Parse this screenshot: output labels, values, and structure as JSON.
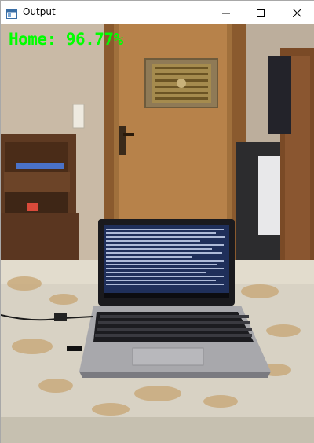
{
  "window": {
    "title": "Output",
    "icon": "opencv-window-icon"
  },
  "controls": {
    "minimize_icon": "minimize-icon",
    "maximize_icon": "maximize-icon",
    "close_icon": "close-icon"
  },
  "overlay": {
    "label": "Home: 96.77%",
    "color": "#00ff00"
  },
  "scene": {
    "description_icon": "camera-frame-image"
  }
}
